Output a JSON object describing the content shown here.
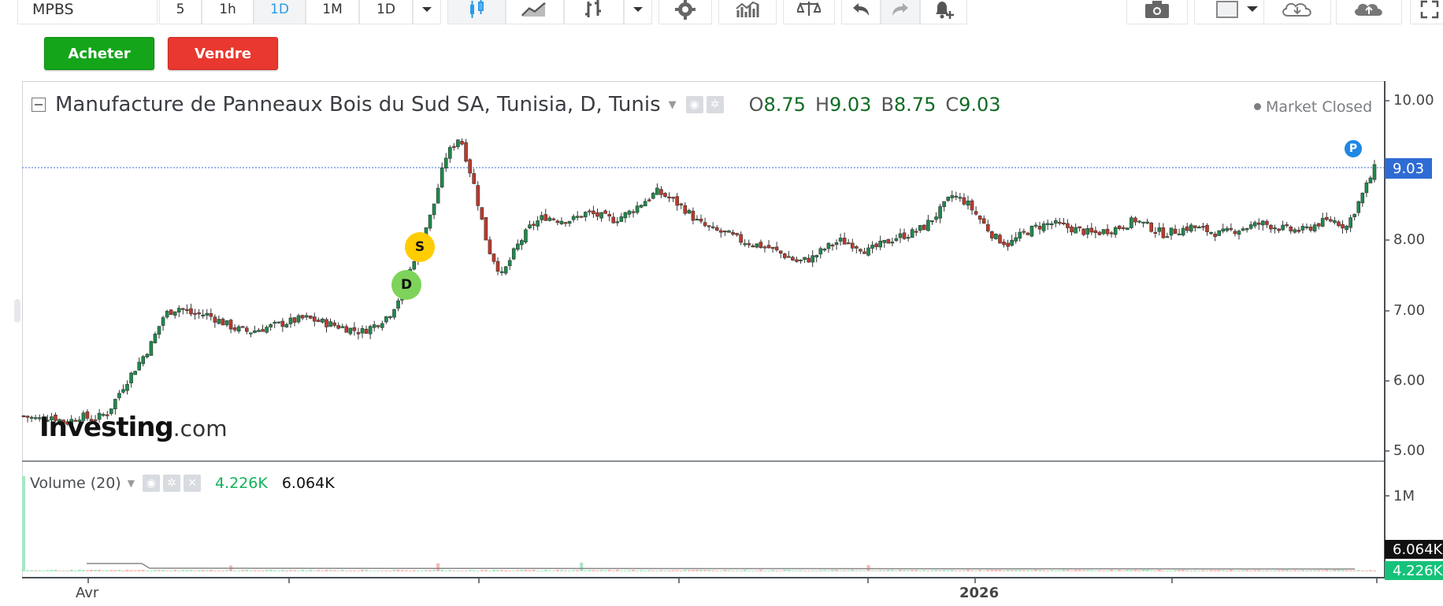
{
  "toolbar": {
    "symbol": "MPBS",
    "intervals": [
      "5",
      "1h",
      "1D",
      "1M",
      "1D"
    ],
    "active_interval": "1D"
  },
  "trade": {
    "buy_label": "Acheter",
    "sell_label": "Vendre"
  },
  "legend": {
    "title": "Manufacture de Panneaux Bois du Sud SA, Tunisia, D, Tunis",
    "open_key": "O",
    "open": "8.75",
    "high_key": "H",
    "high": "9.03",
    "low_key": "B",
    "low": "8.75",
    "close_key": "C",
    "close": "9.03"
  },
  "market_status": "Market Closed",
  "price_axis": [
    "10.00",
    "9.03",
    "8.00",
    "7.00",
    "6.00",
    "5.00"
  ],
  "current_price": "9.03",
  "volume": {
    "label": "Volume (20)",
    "value1": "4.226K",
    "value2": "6.064K",
    "axis_label": "1M"
  },
  "time_axis": [
    "Avr",
    "2026"
  ],
  "markers": {
    "dividend": "D",
    "split": "S",
    "pivot": "P"
  },
  "logo": {
    "brand": "Investing",
    "suffix": ".com"
  },
  "colors": {
    "up": "#1f8a4c",
    "down": "#c0392b",
    "buy": "#14a51a",
    "sell": "#e8382f",
    "price_tag": "#2f6bd4"
  },
  "chart_data": {
    "type": "candlestick",
    "y_range": [
      4.9,
      10.2
    ],
    "close_path": [
      [
        0,
        5.5
      ],
      [
        1,
        5.45
      ],
      [
        2,
        5.5
      ],
      [
        3,
        5.4
      ],
      [
        4,
        5.5
      ],
      [
        5,
        5.45
      ],
      [
        6,
        5.55
      ],
      [
        7,
        5.9
      ],
      [
        8,
        6.2
      ],
      [
        9,
        6.5
      ],
      [
        10,
        6.95
      ],
      [
        11,
        7.05
      ],
      [
        12,
        6.95
      ],
      [
        13,
        6.95
      ],
      [
        14,
        6.85
      ],
      [
        15,
        6.75
      ],
      [
        16,
        6.7
      ],
      [
        17,
        6.75
      ],
      [
        18,
        6.8
      ],
      [
        19,
        6.85
      ],
      [
        20,
        6.9
      ],
      [
        21,
        6.85
      ],
      [
        22,
        6.8
      ],
      [
        23,
        6.75
      ],
      [
        24,
        6.7
      ],
      [
        25,
        6.8
      ],
      [
        26,
        6.95
      ],
      [
        27,
        7.3
      ],
      [
        28,
        7.9
      ],
      [
        29,
        8.4
      ],
      [
        30,
        9.2
      ],
      [
        31,
        9.5
      ],
      [
        32,
        8.8
      ],
      [
        33,
        7.9
      ],
      [
        34,
        7.5
      ],
      [
        35,
        7.9
      ],
      [
        36,
        8.2
      ],
      [
        37,
        8.35
      ],
      [
        38,
        8.3
      ],
      [
        39,
        8.3
      ],
      [
        40,
        8.4
      ],
      [
        41,
        8.35
      ],
      [
        42,
        8.3
      ],
      [
        43,
        8.4
      ],
      [
        44,
        8.55
      ],
      [
        45,
        8.7
      ],
      [
        46,
        8.6
      ],
      [
        47,
        8.45
      ],
      [
        48,
        8.25
      ],
      [
        49,
        8.15
      ],
      [
        50,
        8.1
      ],
      [
        51,
        8.0
      ],
      [
        52,
        7.95
      ],
      [
        53,
        7.9
      ],
      [
        54,
        7.8
      ],
      [
        55,
        7.7
      ],
      [
        56,
        7.75
      ],
      [
        57,
        7.9
      ],
      [
        58,
        8.0
      ],
      [
        59,
        7.95
      ],
      [
        60,
        7.85
      ],
      [
        61,
        7.95
      ],
      [
        62,
        8.05
      ],
      [
        63,
        8.1
      ],
      [
        64,
        8.2
      ],
      [
        65,
        8.4
      ],
      [
        66,
        8.65
      ],
      [
        67,
        8.55
      ],
      [
        68,
        8.3
      ],
      [
        69,
        8.05
      ],
      [
        70,
        7.95
      ],
      [
        71,
        8.1
      ],
      [
        72,
        8.2
      ],
      [
        73,
        8.25
      ],
      [
        74,
        8.2
      ],
      [
        75,
        8.15
      ],
      [
        76,
        8.1
      ],
      [
        77,
        8.15
      ],
      [
        78,
        8.2
      ],
      [
        79,
        8.3
      ],
      [
        80,
        8.2
      ],
      [
        81,
        8.1
      ],
      [
        82,
        8.15
      ],
      [
        83,
        8.2
      ],
      [
        84,
        8.15
      ],
      [
        85,
        8.1
      ],
      [
        86,
        8.15
      ],
      [
        87,
        8.2
      ],
      [
        88,
        8.25
      ],
      [
        89,
        8.2
      ],
      [
        90,
        8.15
      ],
      [
        91,
        8.15
      ],
      [
        92,
        8.25
      ],
      [
        93,
        8.3
      ],
      [
        94,
        8.2
      ],
      [
        95,
        8.6
      ],
      [
        96,
        9.03
      ]
    ],
    "volume_spikes": [
      [
        0,
        1300000
      ],
      [
        15,
        80000
      ],
      [
        29,
        110000
      ],
      [
        40,
        120000
      ],
      [
        60,
        85000
      ]
    ]
  }
}
